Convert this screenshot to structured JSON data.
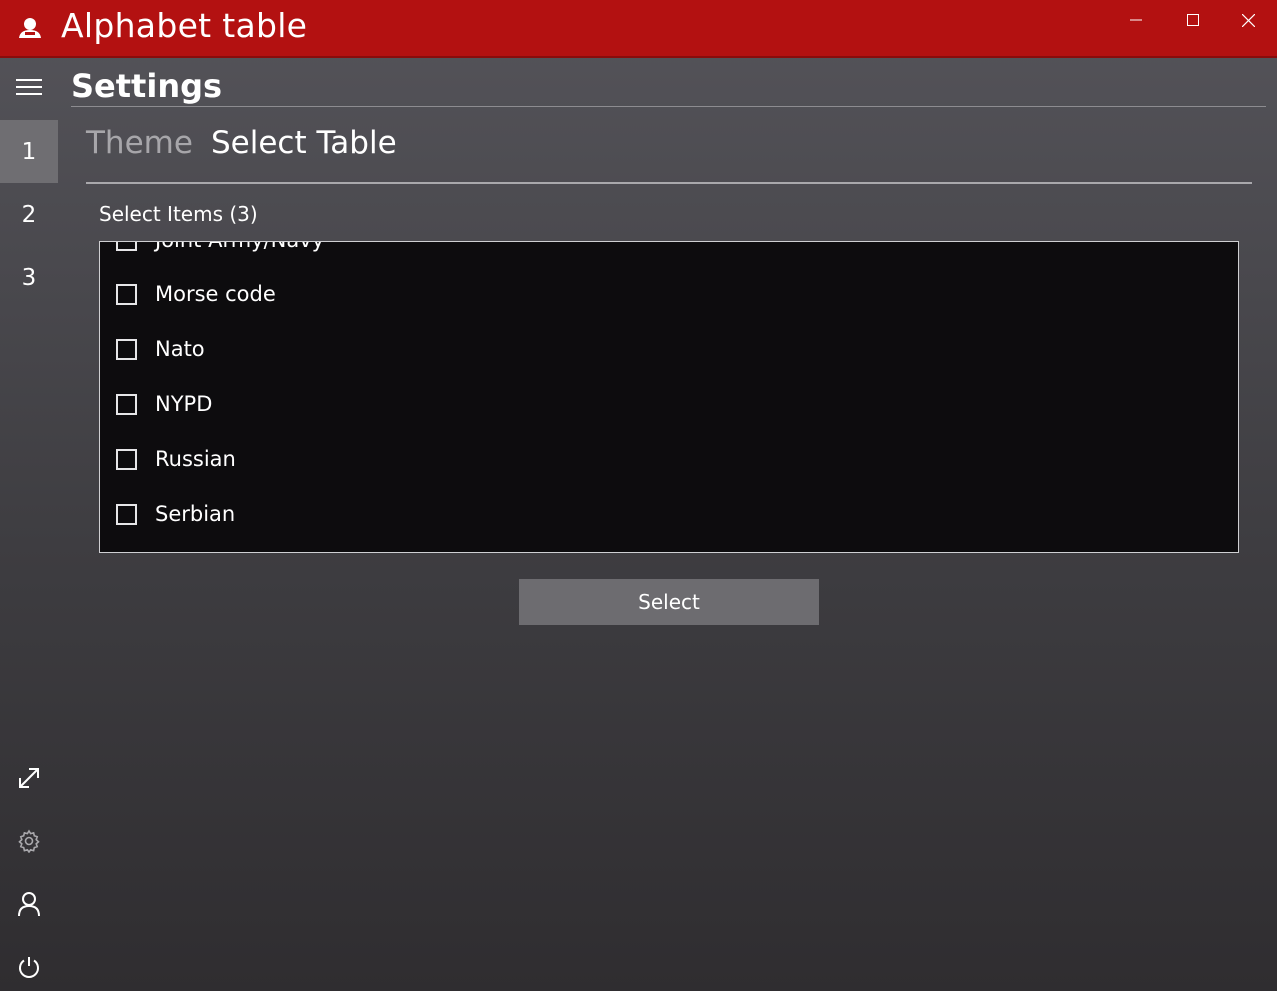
{
  "window": {
    "title": "Alphabet table",
    "accent_color": "#b31111",
    "app_icon": "person-icon",
    "controls": {
      "minimize_icon": "minimize-icon",
      "maximize_icon": "maximize-icon",
      "close_icon": "close-icon"
    }
  },
  "nav": {
    "menu_icon": "hamburger-icon",
    "items": [
      {
        "label": "1",
        "selected": true
      },
      {
        "label": "2",
        "selected": false
      },
      {
        "label": "3",
        "selected": false
      }
    ],
    "bottom_icons": [
      "resize-icon",
      "gear-icon",
      "user-icon",
      "power-icon"
    ]
  },
  "page": {
    "title": "Settings",
    "tabs": [
      {
        "label": "Theme",
        "active": false
      },
      {
        "label": "Select Table",
        "active": true
      }
    ]
  },
  "list": {
    "header": "Select Items (3)",
    "items": [
      {
        "label": "Joint Army/Navy",
        "checked": false
      },
      {
        "label": "Morse code",
        "checked": false
      },
      {
        "label": "Nato",
        "checked": false
      },
      {
        "label": "NYPD",
        "checked": false
      },
      {
        "label": "Russian",
        "checked": false
      },
      {
        "label": "Serbian",
        "checked": false
      }
    ]
  },
  "actions": {
    "select_label": "Select"
  }
}
